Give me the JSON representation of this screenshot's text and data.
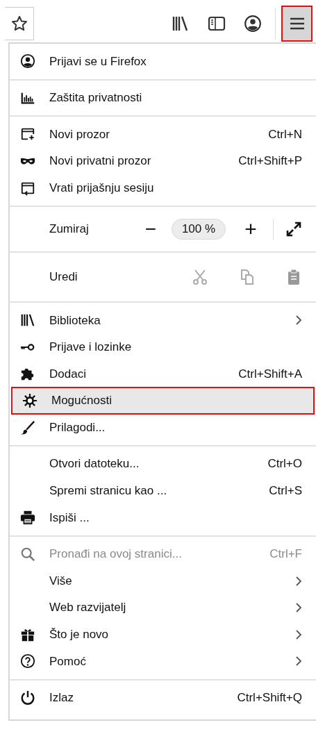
{
  "toolbar": {
    "menu_button": {
      "highlighted": true
    }
  },
  "menu": {
    "sections": [
      {
        "items": [
          {
            "kind": "item",
            "label": "Prijavi se u Firefox",
            "selected": false,
            "disabled": false,
            "submenu": false
          }
        ]
      },
      {
        "items": [
          {
            "kind": "item",
            "label": "Zaštita privatnosti",
            "selected": false,
            "disabled": false,
            "submenu": false
          }
        ]
      },
      {
        "items": [
          {
            "kind": "item",
            "label": "Novi prozor",
            "shortcut": "Ctrl+N",
            "selected": false,
            "disabled": false,
            "submenu": false
          },
          {
            "kind": "item",
            "label": "Novi privatni prozor",
            "shortcut": "Ctrl+Shift+P",
            "selected": false,
            "disabled": false,
            "submenu": false
          },
          {
            "kind": "item",
            "label": "Vrati prijašnju sesiju",
            "selected": false,
            "disabled": false,
            "submenu": false
          }
        ]
      },
      {
        "items": [
          {
            "kind": "zoom",
            "label": "Zumiraj",
            "minus": "−",
            "value": "100 %",
            "plus": "+"
          }
        ]
      },
      {
        "items": [
          {
            "kind": "edit",
            "label": "Uredi"
          }
        ]
      },
      {
        "items": [
          {
            "kind": "item",
            "label": "Biblioteka",
            "selected": false,
            "disabled": false,
            "submenu": true
          },
          {
            "kind": "item",
            "label": "Prijave i lozinke",
            "selected": false,
            "disabled": false,
            "submenu": false
          },
          {
            "kind": "item",
            "label": "Dodaci",
            "shortcut": "Ctrl+Shift+A",
            "selected": false,
            "disabled": false,
            "submenu": false
          },
          {
            "kind": "item",
            "label": "Mogućnosti",
            "selected": true,
            "disabled": false,
            "submenu": false
          },
          {
            "kind": "item",
            "label": "Prilagodi...",
            "selected": false,
            "disabled": false,
            "submenu": false
          }
        ]
      },
      {
        "items": [
          {
            "kind": "item",
            "label": "Otvori datoteku...",
            "shortcut": "Ctrl+O",
            "selected": false,
            "disabled": false,
            "submenu": false
          },
          {
            "kind": "item",
            "label": "Spremi stranicu kao ...",
            "shortcut": "Ctrl+S",
            "selected": false,
            "disabled": false,
            "submenu": false
          },
          {
            "kind": "item",
            "label": "Ispiši ...",
            "selected": false,
            "disabled": false,
            "submenu": false
          }
        ]
      },
      {
        "items": [
          {
            "kind": "item",
            "label": "Pronađi na ovoj stranici...",
            "shortcut": "Ctrl+F",
            "selected": false,
            "disabled": true,
            "submenu": false
          },
          {
            "kind": "item",
            "label": "Više",
            "selected": false,
            "disabled": false,
            "submenu": true
          },
          {
            "kind": "item",
            "label": "Web razvijatelj",
            "selected": false,
            "disabled": false,
            "submenu": true
          },
          {
            "kind": "item",
            "label": "Što je novo",
            "selected": false,
            "disabled": false,
            "submenu": true
          },
          {
            "kind": "item",
            "label": "Pomoć",
            "selected": false,
            "disabled": false,
            "submenu": true
          }
        ]
      },
      {
        "items": [
          {
            "kind": "item",
            "label": "Izlaz",
            "shortcut": "Ctrl+Shift+Q",
            "selected": false,
            "disabled": false,
            "submenu": false
          }
        ]
      }
    ]
  }
}
